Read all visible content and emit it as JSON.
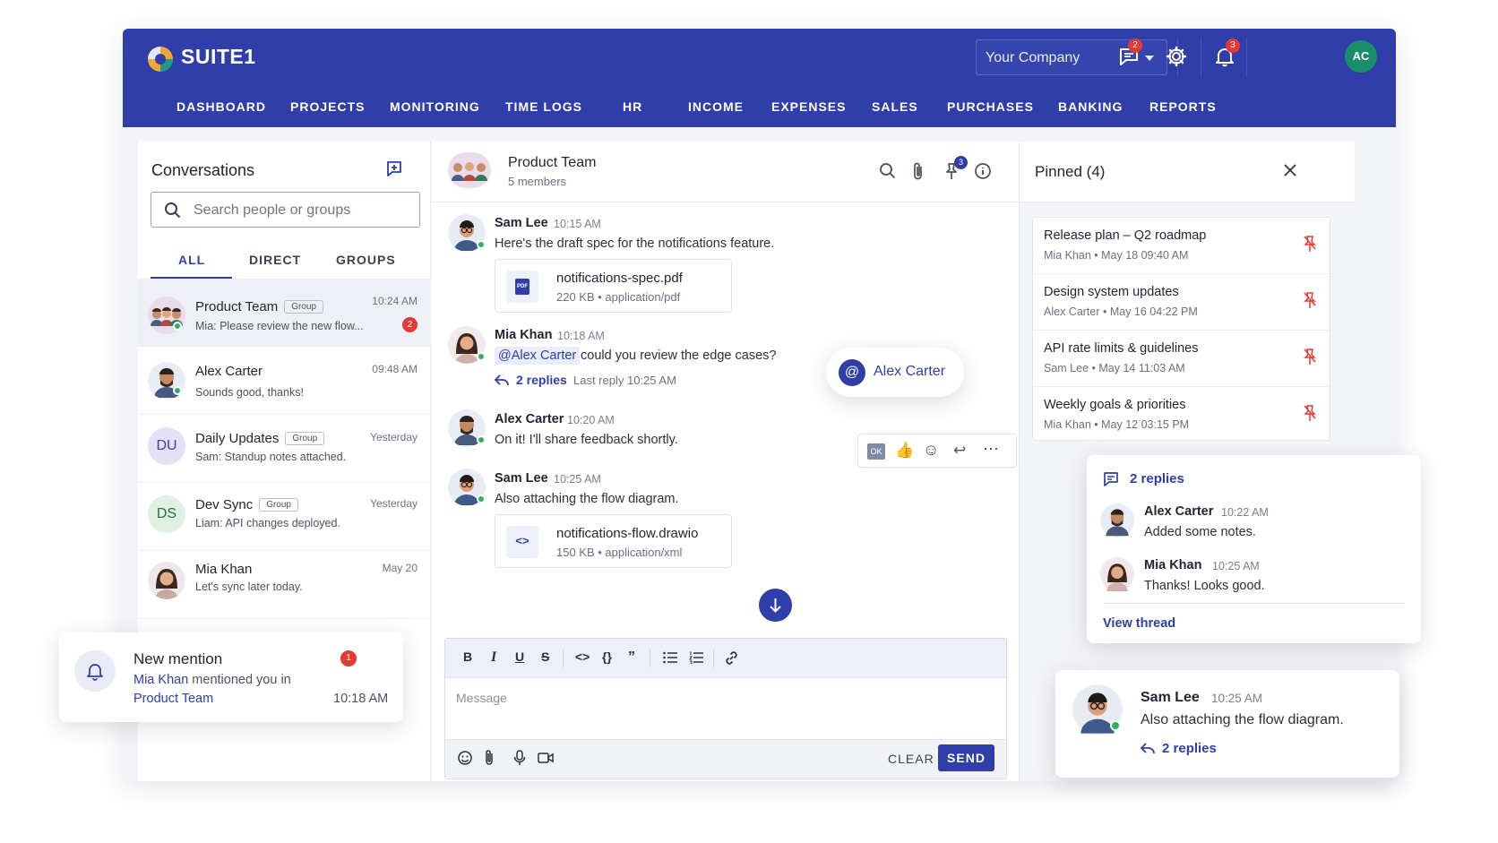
{
  "brand": {
    "name": "SUITE1",
    "colors": {
      "primary": "#2f3ea9",
      "notify": "#e53935",
      "online": "#2fb15a",
      "avatar_ac": "#1a8d6a"
    }
  },
  "topbar": {
    "company": "Your Company",
    "messages_badge": "2",
    "notifications_badge": "3",
    "avatar_initials": "AC",
    "icons": [
      "chat-icon",
      "gear-icon",
      "bell-icon"
    ]
  },
  "nav": [
    "DASHBOARD",
    "PROJECTS",
    "MONITORING",
    "TIME LOGS",
    "HR",
    "INCOME",
    "EXPENSES",
    "SALES",
    "PURCHASES",
    "BANKING",
    "REPORTS"
  ],
  "conversations": {
    "title": "Conversations",
    "search_placeholder": "Search people or groups",
    "tabs": [
      "ALL",
      "DIRECT",
      "GROUPS"
    ],
    "active_tab": "ALL",
    "items": [
      {
        "name": "Product Team",
        "tag": "Group",
        "preview": "Mia: Please review the new flow...",
        "time": "10:24 AM",
        "unread": "2",
        "selected": true
      },
      {
        "name": "Alex Carter",
        "tag": "",
        "preview": "Sounds good, thanks!",
        "time": "09:48 AM"
      },
      {
        "name": "Daily Updates",
        "tag": "Group",
        "preview": "Sam: Standup notes attached.",
        "time": "Yesterday",
        "initials": "DU"
      },
      {
        "name": "Dev Sync",
        "tag": "Group",
        "preview": "Liam: API changes deployed.",
        "time": "Yesterday",
        "initials": "DS"
      },
      {
        "name": "Mia Khan",
        "tag": "",
        "preview": "Let's sync later today.",
        "time": "May 20"
      }
    ]
  },
  "chat": {
    "title": "Product Team",
    "subtitle": "5 members",
    "pin_badge": "3",
    "messages": [
      {
        "author": "Sam Lee",
        "time": "10:15 AM",
        "text": "Here's the draft spec for the notifications feature.",
        "file": {
          "name": "notifications-spec.pdf",
          "meta": "220 KB • application/pdf",
          "icon_text": "PDF"
        }
      },
      {
        "author": "Mia Khan",
        "time": "10:18 AM",
        "mention": "@Alex Carter",
        "text": "could you review the edge cases?",
        "replies": "2 replies",
        "last_reply": "Last reply 10:25 AM"
      },
      {
        "author": "Alex Carter",
        "time": "10:20 AM",
        "text": "On it! I'll share feedback shortly."
      },
      {
        "author": "Sam Lee",
        "time": "10:25 AM",
        "text": "Also attaching the flow diagram.",
        "file": {
          "name": "notifications-flow.drawio",
          "meta": "150 KB • application/xml",
          "icon_text": "<>"
        }
      }
    ],
    "reactions": [
      "OK",
      "👍",
      "☺",
      "↩",
      "⋯"
    ],
    "composer": {
      "placeholder": "Message",
      "clear": "CLEAR",
      "send": "SEND"
    }
  },
  "mention_popup": {
    "label": "Alex Carter"
  },
  "pinned": {
    "title": "Pinned (4)",
    "items": [
      {
        "title": "Release plan – Q2 roadmap",
        "meta": "Mia Khan • May 18 09:40 AM"
      },
      {
        "title": "Design system updates",
        "meta": "Alex Carter • May 16 04:22 PM"
      },
      {
        "title": "API rate limits & guidelines",
        "meta": "Sam Lee • May 14 11:03 AM"
      },
      {
        "title": "Weekly goals & priorities",
        "meta": "Mia Khan • May 12 03:15 PM"
      }
    ]
  },
  "thread_card": {
    "replies": "2 replies",
    "items": [
      {
        "author": "Alex Carter",
        "time": "10:22 AM",
        "text": "Added some notes."
      },
      {
        "author": "Mia Khan",
        "time": "10:25 AM",
        "text": "Thanks! Looks good."
      }
    ],
    "view": "View thread"
  },
  "message_card": {
    "author": "Sam Lee",
    "time": "10:25 AM",
    "text": "Also attaching the flow diagram.",
    "replies": "2 replies"
  },
  "notification": {
    "title": "New mention",
    "badge": "1",
    "who": "Mia Khan",
    "action": "mentioned you in",
    "where": "Product Team",
    "time": "10:18 AM"
  }
}
